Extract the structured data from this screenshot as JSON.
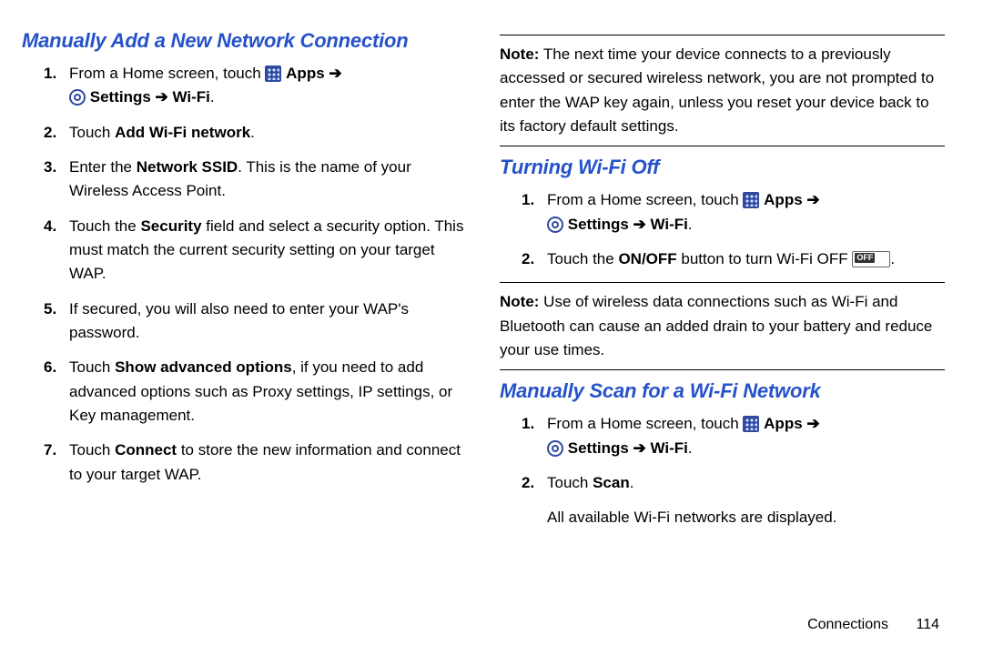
{
  "footer": {
    "section": "Connections",
    "page": "114"
  },
  "leftCol": {
    "title": "Manually Add a New Network Connection",
    "steps": {
      "s1a": "From a Home screen, touch ",
      "apps": "Apps",
      "arrow": " ➔ ",
      "settings": "Settings",
      "wifi": "Wi-Fi",
      "s2a": "Touch ",
      "s2b": "Add Wi-Fi network",
      "s3a": "Enter the ",
      "s3b": "Network SSID",
      "s3c": ". This is the name of your Wireless Access Point.",
      "s4a": "Touch the ",
      "s4b": "Security",
      "s4c": " field and select a security option. This must match the current security setting on your target WAP.",
      "s5": "If secured, you will also need to enter your WAP's password.",
      "s6a": "Touch ",
      "s6b": "Show advanced options",
      "s6c": ", if you need to add advanced options such as Proxy settings, IP settings, or Key management.",
      "s7a": "Touch ",
      "s7b": "Connect",
      "s7c": " to store the new information and connect to your target WAP."
    }
  },
  "rightCol": {
    "note1a": "Note:",
    "note1b": " The next time your device connects to a previously accessed or secured wireless network, you are not prompted to enter the WAP key again, unless you reset your device back to its factory default settings.",
    "title2": "Turning Wi-Fi Off",
    "t2s1a": "From a Home screen, touch ",
    "apps": "Apps",
    "arrow": " ➔ ",
    "settings": "Settings",
    "wifi": "Wi-Fi",
    "t2s2a": "Touch the ",
    "t2s2b": "ON/OFF",
    "t2s2c": " button to turn Wi-Fi OFF ",
    "note2a": "Note:",
    "note2b": " Use of wireless data connections such as Wi-Fi and Bluetooth can cause an added drain to your battery and reduce your use times.",
    "title3": "Manually Scan for a Wi-Fi Network",
    "t3s1a": "From a Home screen, touch ",
    "t3s2a": "Touch ",
    "t3s2b": "Scan",
    "t3after": "All available Wi-Fi networks are displayed."
  },
  "period": "."
}
